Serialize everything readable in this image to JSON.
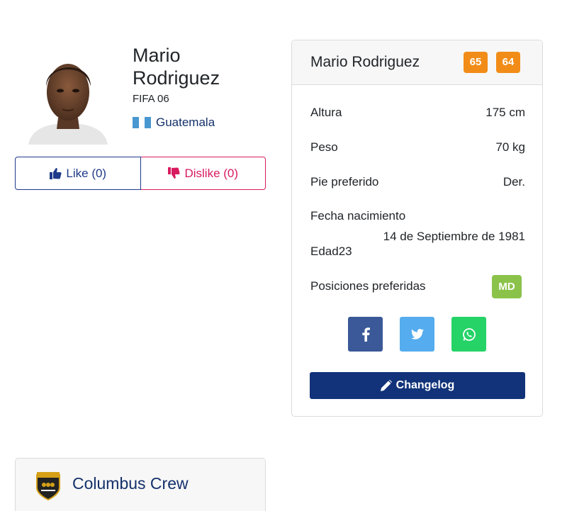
{
  "player": {
    "name": "Mario Rodriguez",
    "game": "FIFA 06",
    "nation": "Guatemala"
  },
  "votes": {
    "like_label": "Like (0)",
    "dislike_label": "Dislike (0)"
  },
  "card": {
    "title": "Mario Rodriguez",
    "ratings": [
      "65",
      "64"
    ],
    "stats": [
      {
        "label": "Altura",
        "value": "175 cm"
      },
      {
        "label": "Peso",
        "value": "70 kg"
      },
      {
        "label": "Pie preferido",
        "value": "Der."
      }
    ],
    "birth_label": "Fecha nacimiento",
    "birth_value": "14 de Septiembre de 1981",
    "age_label": "Edad",
    "age_value": "23",
    "positions_label": "Posiciones preferidas",
    "positions": [
      "MD"
    ],
    "changelog_label": "Changelog"
  },
  "share": {
    "icons": [
      "facebook-icon",
      "twitter-icon",
      "whatsapp-icon"
    ]
  },
  "club": {
    "name": "Columbus Crew"
  },
  "colors": {
    "rating": "#f28c18",
    "position": "#8bc34a",
    "primary": "#12337a",
    "like": "#1f3a8a",
    "dislike": "#d81b60"
  }
}
